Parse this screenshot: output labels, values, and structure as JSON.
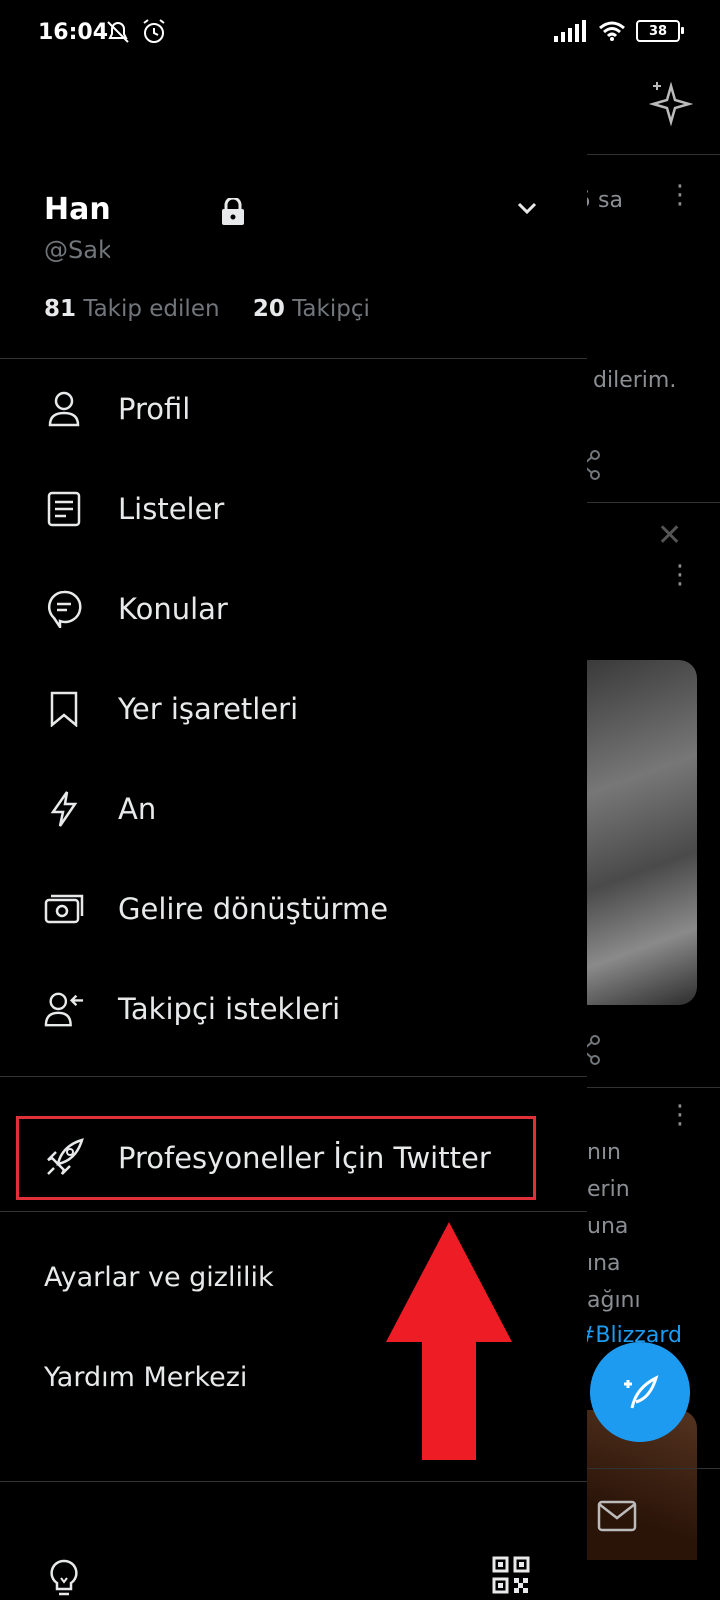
{
  "status_bar": {
    "time": "16:04",
    "battery": "38"
  },
  "account": {
    "name": "Han",
    "handle": "@Sak",
    "following_count": "81",
    "following_label": "Takip edilen",
    "followers_count": "20",
    "followers_label": "Takipçi"
  },
  "menu": [
    {
      "label": "Profil",
      "icon": "person-icon"
    },
    {
      "label": "Listeler",
      "icon": "list-icon"
    },
    {
      "label": "Konular",
      "icon": "topics-icon"
    },
    {
      "label": "Yer işaretleri",
      "icon": "bookmark-icon"
    },
    {
      "label": "An",
      "icon": "lightning-icon"
    },
    {
      "label": "Gelire dönüştürme",
      "icon": "money-icon"
    },
    {
      "label": "Takipçi istekleri",
      "icon": "follower-request-icon"
    }
  ],
  "professional": {
    "label": "Profesyoneller İçin Twitter",
    "icon": "rocket-icon"
  },
  "settings": {
    "settings_label": "Ayarlar ve gizlilik",
    "help_label": "Yardım Merkezi"
  },
  "feed": {
    "time": "5 sa",
    "text1": "r dilerim.",
    "lines": [
      "nın",
      "erin",
      "una",
      "ına",
      "ağını"
    ],
    "hashtag": "#Blizzard"
  },
  "colors": {
    "accent": "#1d9bf0",
    "highlight": "#e0303a",
    "arrow": "#ee1c25"
  }
}
